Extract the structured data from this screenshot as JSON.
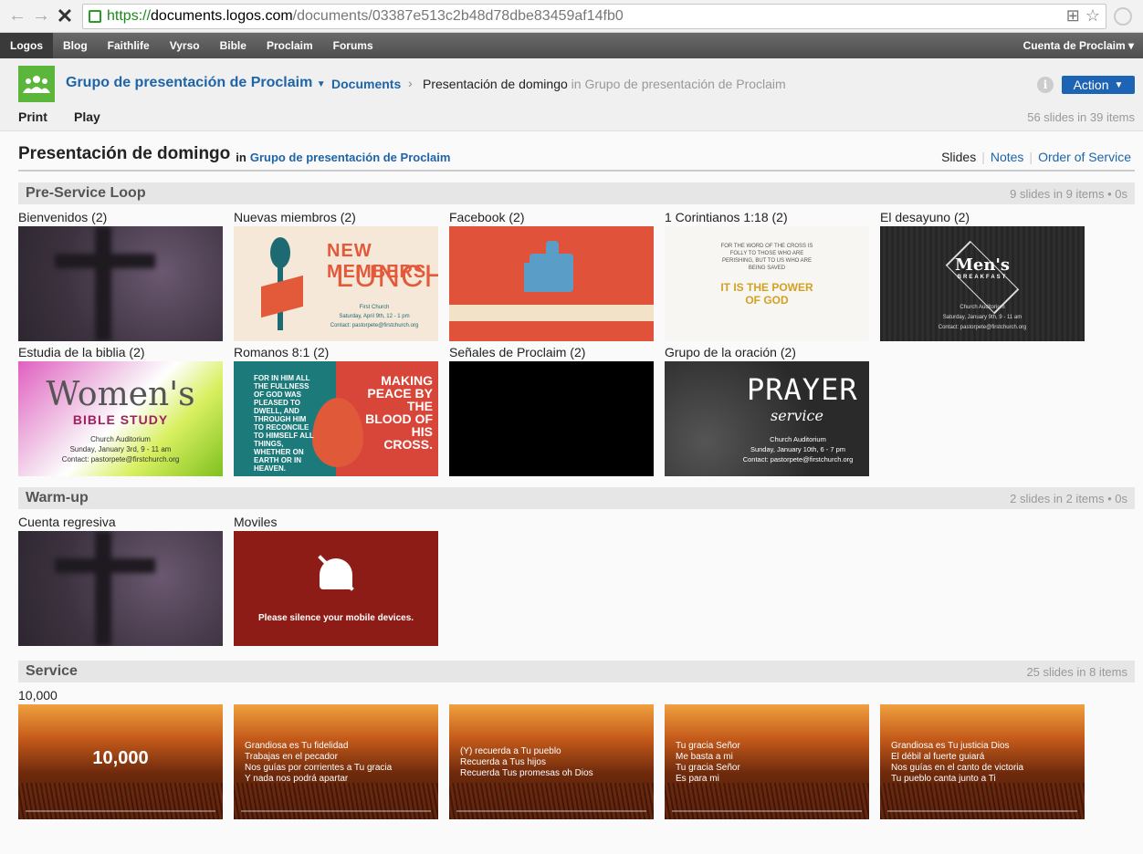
{
  "browser": {
    "url_https": "https://",
    "url_host": "documents.logos.com",
    "url_path": "/documents/03387e513c2b48d78dbe83459af14fb0"
  },
  "topnav": {
    "items": [
      "Logos",
      "Blog",
      "Faithlife",
      "Vyrso",
      "Bible",
      "Proclaim",
      "Forums"
    ],
    "account": "Cuenta de Proclaim ▾"
  },
  "header": {
    "group_name": "Grupo de presentación de Proclaim",
    "crumb_docs": "Documents",
    "crumb_current": "Presentación de domingo",
    "crumb_in": "in Grupo de presentación de Proclaim",
    "action_label": "Action",
    "print_label": "Print",
    "play_label": "Play",
    "summary": "56 slides in 39 items"
  },
  "doc": {
    "title": "Presentación de domingo",
    "in": "in",
    "group": "Grupo de presentación de Proclaim",
    "views": [
      "Slides",
      "Notes",
      "Order of Service"
    ]
  },
  "sections": [
    {
      "name": "Pre-Service Loop",
      "count": "9 slides in 9 items • 0s",
      "tiles": [
        "Bienvenidos (2)",
        "Nuevas miembros (2)",
        "Facebook (2)",
        "1 Corintianos 1:18 (2)",
        "El desayuno (2)",
        "Estudia de la biblia (2)",
        "Romanos 8:1 (2)",
        "Señales de Proclaim (2)",
        "Grupo de la oración (2)"
      ]
    },
    {
      "name": "Warm-up",
      "count": "2 slides in 2 items • 0s",
      "tiles": [
        "Cuenta regresiva",
        "Moviles"
      ]
    },
    {
      "name": "Service",
      "count": "25 slides in 8 items",
      "tiles": [
        "10,000"
      ]
    }
  ],
  "thumbs": {
    "lunch": {
      "t1": "NEW MEMBERS",
      "t2": "LUNCH",
      "l1": "First Church",
      "l2": "Saturday, April 9th, 12 - 1 pm",
      "l3": "Contact: pastorpete@firstchurch.org"
    },
    "cor": {
      "text": "FOR THE WORD OF THE CROSS IS FOLLY TO THOSE WHO ARE PERISHING, BUT TO US WHO ARE BEING SAVED",
      "gold": "IT IS THE POWER OF GOD"
    },
    "men": {
      "title": "Men's",
      "sub": "BREAKFAST",
      "l1": "Church Auditorium",
      "l2": "Saturday, January 9th, 9 - 11 am",
      "l3": "Contact: pastorpete@firstchurch.org"
    },
    "women": {
      "w1": "Women's",
      "w2": "BIBLE STUDY",
      "l1": "Church Auditorium",
      "l2": "Sunday, January 3rd, 9 - 11 am",
      "l3": "Contact: pastorpete@firstchurch.org"
    },
    "rom": {
      "left": "FOR IN HIM ALL THE FULLNESS OF GOD WAS PLEASED TO DWELL, AND THROUGH HIM TO RECONCILE TO HIMSELF ALL THINGS, WHETHER ON EARTH OR IN HEAVEN.",
      "right": "MAKING PEACE BY THE BLOOD OF HIS CROSS."
    },
    "prayer": {
      "p1": "PRAYER",
      "p2": "service",
      "l1": "Church Auditorium",
      "l2": "Sunday, January 10th, 6 - 7 pm",
      "l3": "Contact: pastorpete@firstchurch.org"
    },
    "mobile": {
      "msg": "Please silence your mobile devices."
    },
    "service": {
      "big": "10,000",
      "s2": [
        "Grandiosa es Tu fidelidad",
        "Trabajas en el pecador",
        "Nos guías por corrientes a Tu gracia",
        "Y nada nos podrá apartar"
      ],
      "s3": [
        "(Y) recuerda a Tu pueblo",
        "Recuerda a Tus hijos",
        "Recuerda Tus promesas oh Dios"
      ],
      "s4": [
        "Tu gracia Señor",
        "Me basta a mi",
        "Tu gracia Señor",
        "Es para mi"
      ],
      "s5": [
        "Grandiosa es Tu justicia Dios",
        "El débil al fuerte guiará",
        "Nos guías en el canto de victoria",
        "Tu pueblo canta junto a Ti"
      ]
    }
  }
}
